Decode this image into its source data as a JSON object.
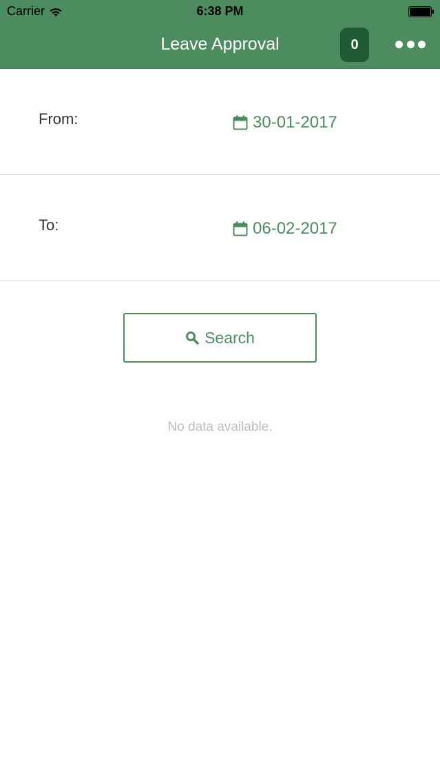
{
  "status_bar": {
    "carrier": "Carrier",
    "time": "6:38 PM",
    "icons": [
      "wifi-icon",
      "battery-icon"
    ]
  },
  "nav": {
    "title": "Leave Approval",
    "counter": "0",
    "more_icon": "more-icon"
  },
  "filters": {
    "from_label": "From:",
    "from_date": "30-01-2017",
    "to_label": "To:",
    "to_date": "06-02-2017",
    "date_icon": "calendar-icon"
  },
  "search": {
    "label": "Search",
    "icon": "search-icon"
  },
  "empty_message": "No data available.",
  "colors": {
    "accent": "#4c8c5f",
    "badge": "#1f5a34",
    "muted_text": "#bdbdbd",
    "divider": "#d9d9d9"
  }
}
